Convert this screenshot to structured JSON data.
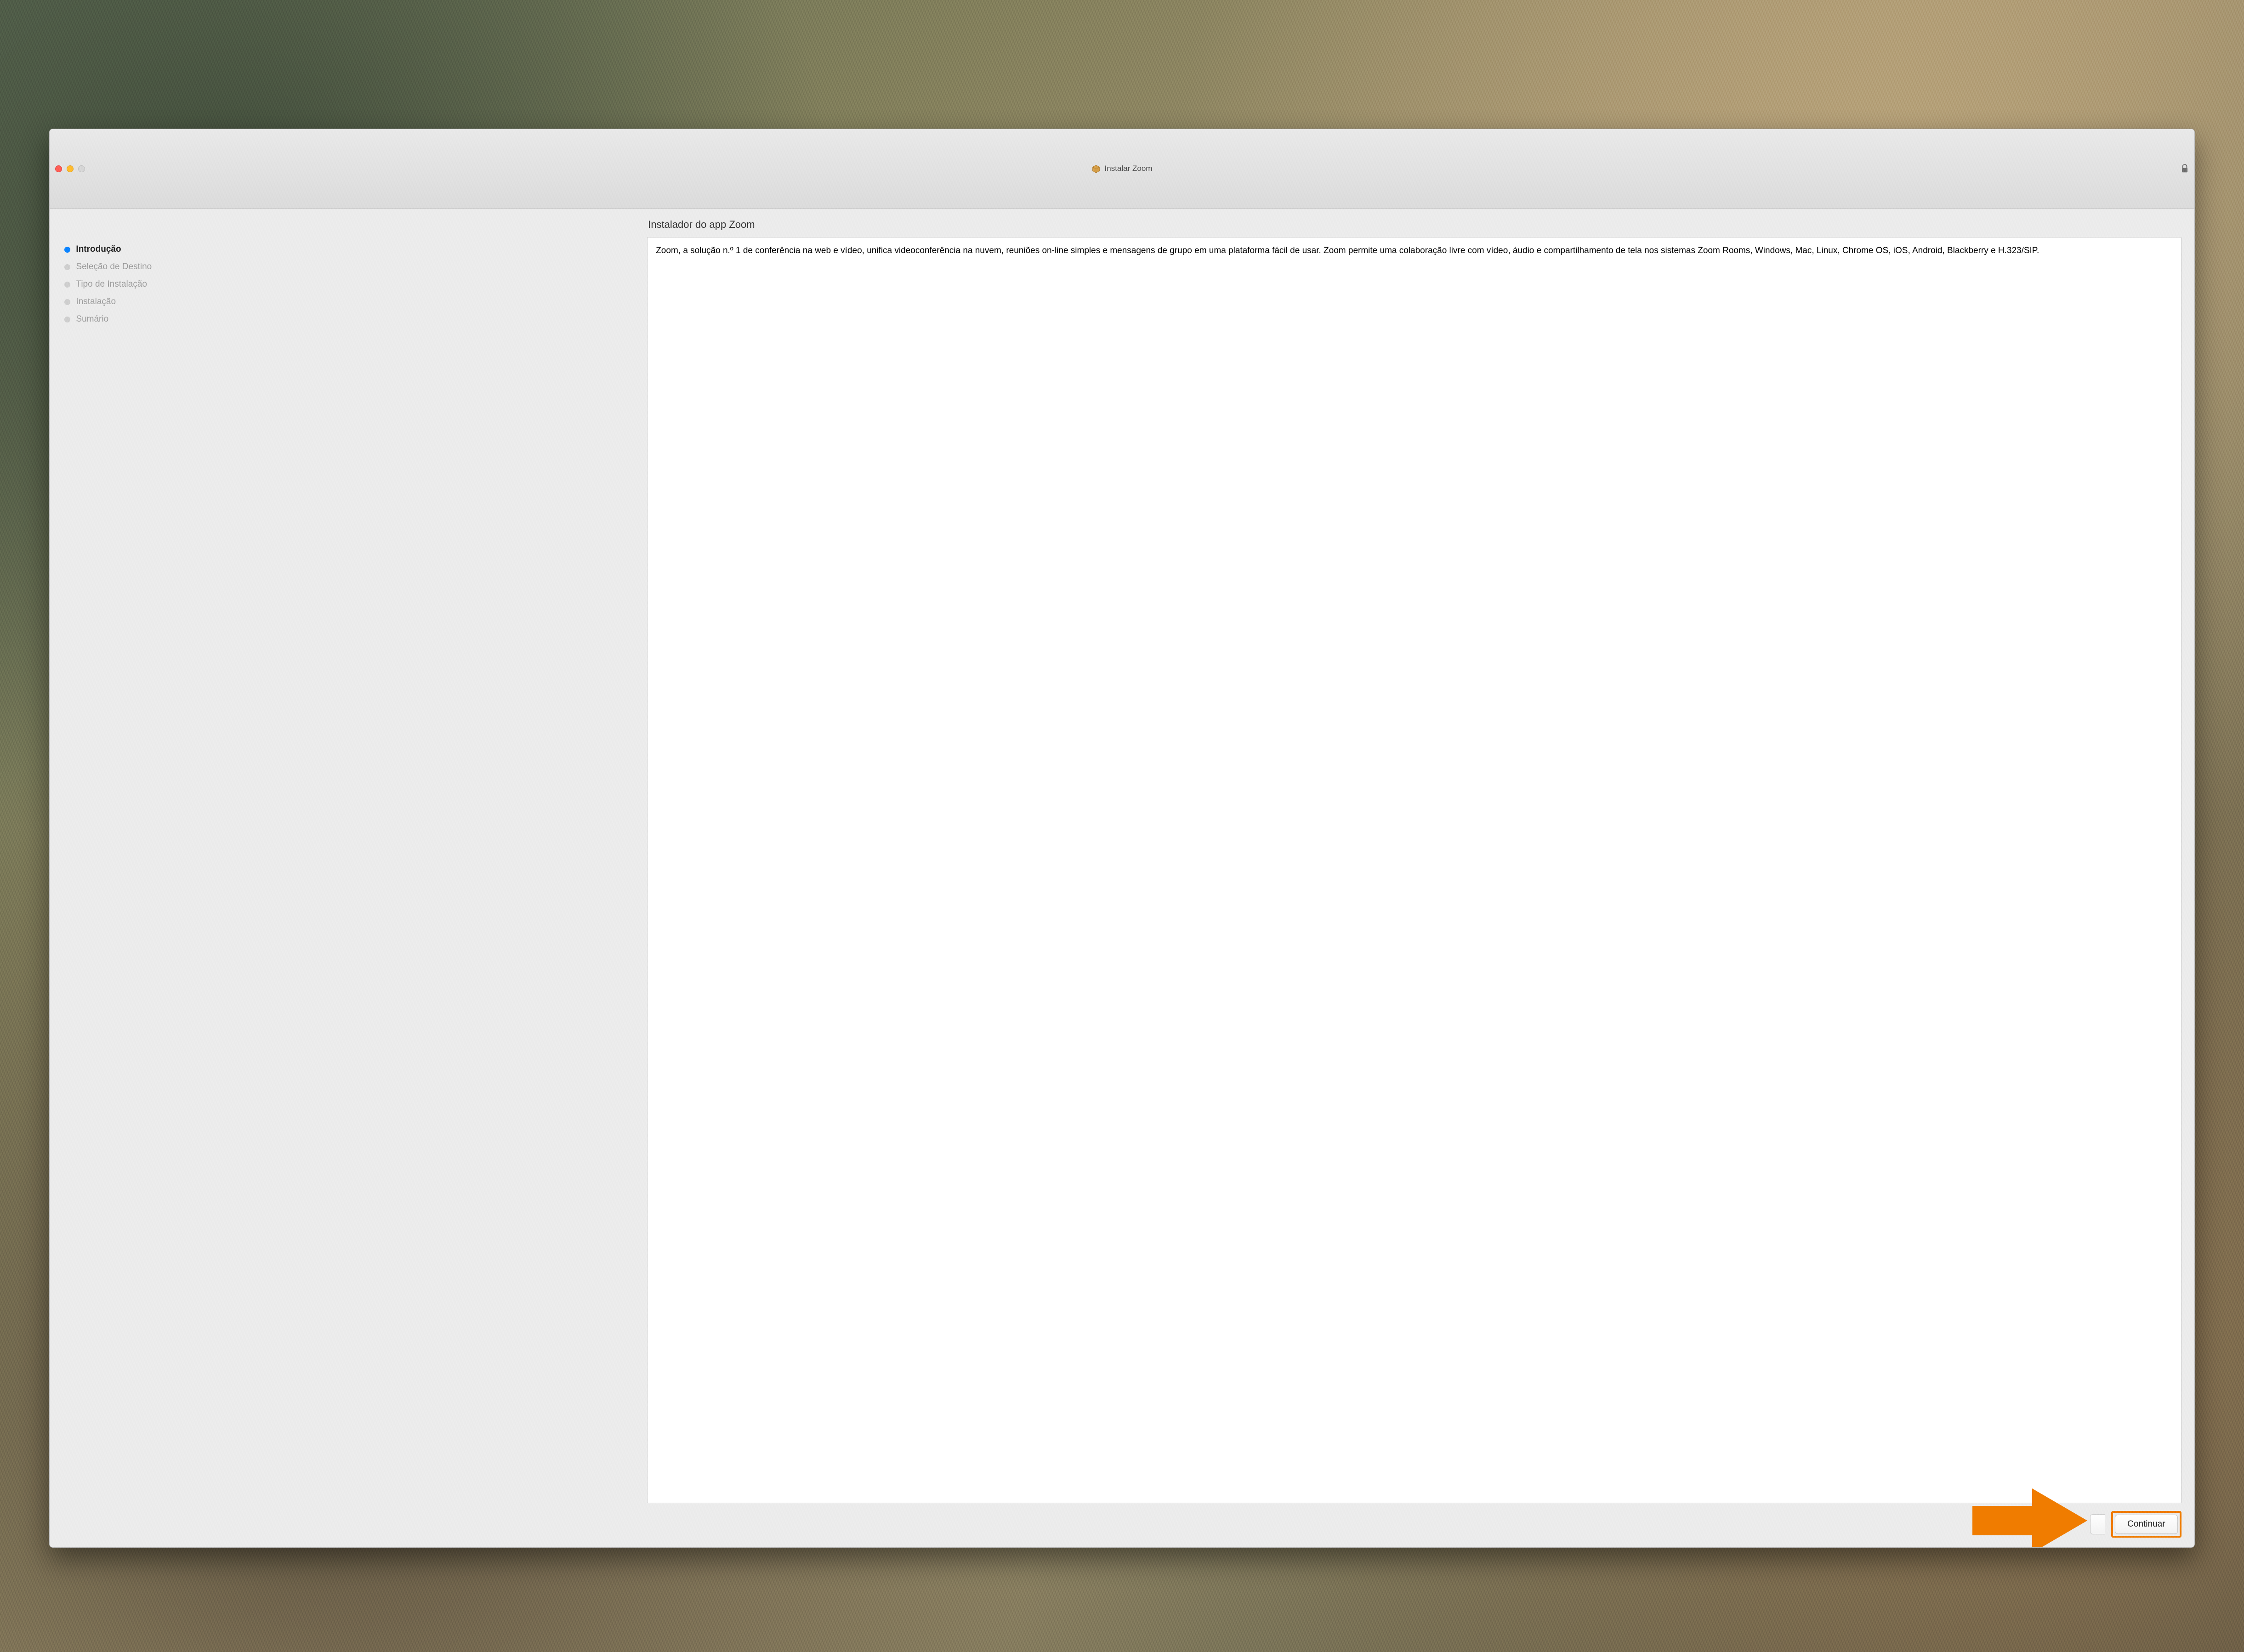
{
  "window": {
    "title": "Instalar Zoom"
  },
  "sidebar": {
    "steps": [
      {
        "label": "Introdução",
        "active": true
      },
      {
        "label": "Seleção de Destino",
        "active": false
      },
      {
        "label": "Tipo de Instalação",
        "active": false
      },
      {
        "label": "Instalação",
        "active": false
      },
      {
        "label": "Sumário",
        "active": false
      }
    ]
  },
  "main": {
    "heading": "Instalador do app Zoom",
    "body_text": "Zoom, a solução n.º 1 de conferência na web e vídeo, unifica videoconferência na nuvem, reuniões on-line simples e mensagens de grupo em uma plataforma fácil de usar. Zoom permite uma colaboração livre com vídeo, áudio e compartilhamento de tela nos sistemas Zoom Rooms, Windows, Mac, Linux, Chrome OS, iOS, Android, Blackberry e H.323/SIP."
  },
  "footer": {
    "continue_label": "Continuar"
  },
  "annotation": {
    "arrow_color": "#f07c00"
  }
}
